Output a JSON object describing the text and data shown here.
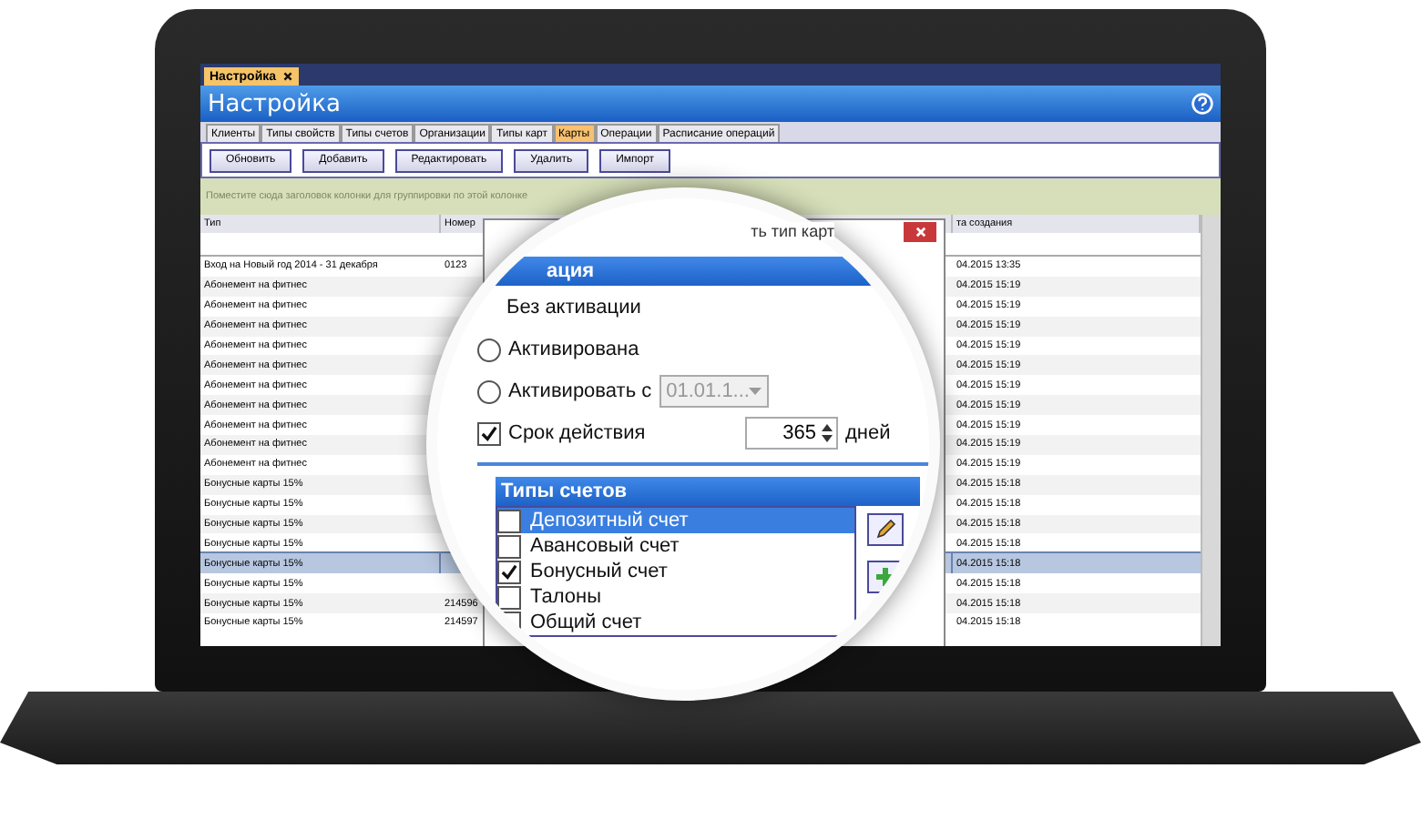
{
  "window_tab": {
    "label": "Настройка"
  },
  "header": {
    "title": "Настройка"
  },
  "tabs": [
    {
      "label": "Клиенты",
      "selected": false
    },
    {
      "label": "Типы свойств",
      "selected": false
    },
    {
      "label": "Типы счетов",
      "selected": false
    },
    {
      "label": "Организации",
      "selected": false
    },
    {
      "label": "Типы карт",
      "selected": false
    },
    {
      "label": "Карты",
      "selected": true
    },
    {
      "label": "Операции",
      "selected": false
    },
    {
      "label": "Расписание операций",
      "selected": false
    }
  ],
  "toolbar": {
    "buttons": [
      "Обновить",
      "Добавить",
      "Редактировать",
      "Удалить",
      "Импорт"
    ]
  },
  "group_panel": {
    "hint": "Поместите сюда заголовок колонки для группировки по этой колонке"
  },
  "table": {
    "columns": [
      "Тип",
      "Номер",
      "та создания"
    ],
    "rows": [
      {
        "type": "Вход на Новый год 2014 - 31 декабря",
        "number": "0123",
        "date": "04.2015 13:35",
        "selected": false
      },
      {
        "type": "Абонемент на фитнес",
        "date": "04.2015 15:19",
        "selected": false
      },
      {
        "type": "Абонемент на фитнес",
        "date": "04.2015 15:19",
        "selected": false
      },
      {
        "type": "Абонемент на фитнес",
        "date": "04.2015 15:19",
        "selected": false
      },
      {
        "type": "Абонемент на фитнес",
        "date": "04.2015 15:19",
        "selected": false
      },
      {
        "type": "Абонемент на фитнес",
        "date": "04.2015 15:19",
        "selected": false
      },
      {
        "type": "Абонемент на фитнес",
        "date": "04.2015 15:19",
        "selected": false
      },
      {
        "type": "Абонемент на фитнес",
        "date": "04.2015 15:19",
        "selected": false
      },
      {
        "type": "Абонемент на фитнес",
        "date": "04.2015 15:19",
        "selected": false
      },
      {
        "type": "Абонемент на фитнес",
        "date": "04.2015 15:19",
        "selected": false
      },
      {
        "type": "Абонемент на фитнес",
        "date": "04.2015 15:19",
        "selected": false
      },
      {
        "type": "Бонусные карты 15%",
        "date": "04.2015 15:18",
        "selected": false
      },
      {
        "type": "Бонусные карты 15%",
        "date": "04.2015 15:18",
        "selected": false
      },
      {
        "type": "Бонусные карты 15%",
        "date": "04.2015 15:18",
        "selected": false
      },
      {
        "type": "Бонусные карты 15%",
        "date": "04.2015 15:18",
        "selected": false
      },
      {
        "type": "Бонусные карты 15%",
        "date": "04.2015 15:18",
        "selected": true
      },
      {
        "type": "Бонусные карты 15%",
        "date": "04.2015 15:18",
        "selected": false
      },
      {
        "type": "Бонусные карты 15%",
        "number": "214596",
        "date": "04.2015 15:18",
        "selected": false
      },
      {
        "type": "Бонусные карты 15%",
        "number": "214597",
        "date": "04.2015 15:18",
        "selected": false
      }
    ]
  },
  "dialog": {
    "title": "ть тип карт"
  },
  "lens": {
    "section": "ация",
    "activation": [
      {
        "kind": "label",
        "label": "Без активации"
      },
      {
        "kind": "radio",
        "label": "Активирована",
        "selected": false
      },
      {
        "kind": "radio-date",
        "label": "Активировать с",
        "selected": false,
        "date": "01.01.1...",
        "disabled": true
      }
    ],
    "validity": {
      "label": "Срок действия",
      "checked": true,
      "value": "365",
      "unit": "дней"
    },
    "accounts": {
      "title": "Типы счетов",
      "items": [
        {
          "label": "Депозитный счет",
          "checked": false,
          "selected": true
        },
        {
          "label": "Авансовый счет",
          "checked": false,
          "selected": false
        },
        {
          "label": "Бонусный счет",
          "checked": true,
          "selected": false
        },
        {
          "label": "Талоны",
          "checked": false,
          "selected": false
        },
        {
          "label": "Общий счет",
          "checked": false,
          "selected": false
        }
      ]
    }
  }
}
